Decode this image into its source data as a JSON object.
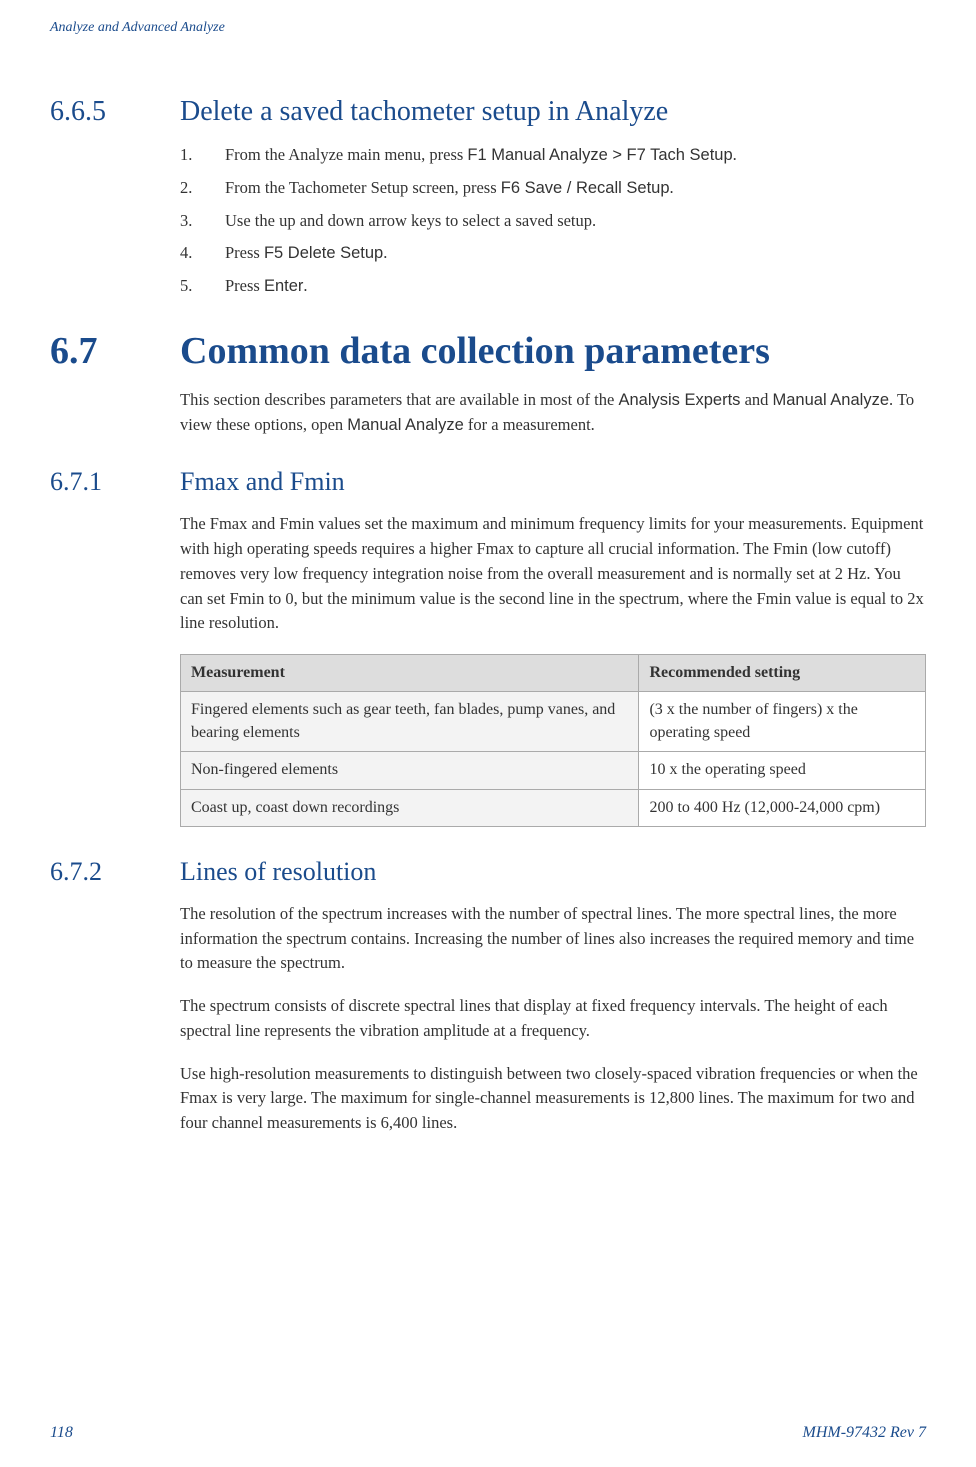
{
  "header": "Analyze and Advanced Analyze",
  "s665": {
    "num": "6.6.5",
    "title": "Delete a saved tachometer setup in Analyze",
    "steps": [
      {
        "n": "1.",
        "pre": "From the Analyze main menu, press ",
        "mono": "F1 Manual Analyze > F7 Tach Setup",
        "post": "."
      },
      {
        "n": "2.",
        "pre": "From the Tachometer Setup screen, press ",
        "mono": "F6 Save / Recall Setup",
        "post": "."
      },
      {
        "n": "3.",
        "pre": "Use the up and down arrow keys to select a saved setup.",
        "mono": "",
        "post": ""
      },
      {
        "n": "4.",
        "pre": "Press ",
        "mono": "F5 Delete Setup",
        "post": "."
      },
      {
        "n": "5.",
        "pre": "Press ",
        "mono": "Enter",
        "post": "."
      }
    ]
  },
  "s67": {
    "num": "6.7",
    "title": "Common data collection parameters",
    "intro_pre": "This section describes parameters that are available in most of the ",
    "intro_m1": "Analysis Experts",
    "intro_mid": " and ",
    "intro_m2": "Manual Analyze",
    "intro_mid2": ". To view these options, open ",
    "intro_m3": "Manual Analyze",
    "intro_post": " for a measurement."
  },
  "s671": {
    "num": "6.7.1",
    "title": "Fmax and Fmin",
    "para": "The Fmax and Fmin values set the maximum and minimum frequency limits for your measurements. Equipment with high operating speeds requires a higher Fmax to capture all crucial information. The Fmin (low cutoff) removes very low frequency integration noise from the overall measurement and is normally set at 2 Hz. You can set Fmin to 0, but the minimum value is the second line in the spectrum, where the Fmin value is equal to 2x line resolution.",
    "table": {
      "h1": "Measurement",
      "h2": "Recommended setting",
      "rows": [
        {
          "c1": "Fingered elements such as gear teeth, fan blades, pump vanes, and bearing elements",
          "c2": "(3 x the number of fingers) x the operating speed"
        },
        {
          "c1": "Non-fingered elements",
          "c2": "10 x the operating speed"
        },
        {
          "c1": "Coast up, coast down recordings",
          "c2": "200 to 400 Hz (12,000-24,000 cpm)"
        }
      ]
    }
  },
  "s672": {
    "num": "6.7.2",
    "title": "Lines of resolution",
    "p1": "The resolution of the spectrum increases with the number of spectral lines. The more spectral lines, the more information the spectrum contains. Increasing the number of lines also increases the required memory and time to measure the spectrum.",
    "p2": "The spectrum consists of discrete spectral lines that display at fixed frequency intervals. The height of each spectral line represents the vibration amplitude at a frequency.",
    "p3": "Use high-resolution measurements to distinguish between two closely-spaced vibration frequencies or when the Fmax is very large. The maximum for single-channel measurements is 12,800 lines. The maximum for two and four channel measurements is 6,400 lines."
  },
  "footer": {
    "page": "118",
    "doc": "MHM-97432 Rev 7"
  }
}
